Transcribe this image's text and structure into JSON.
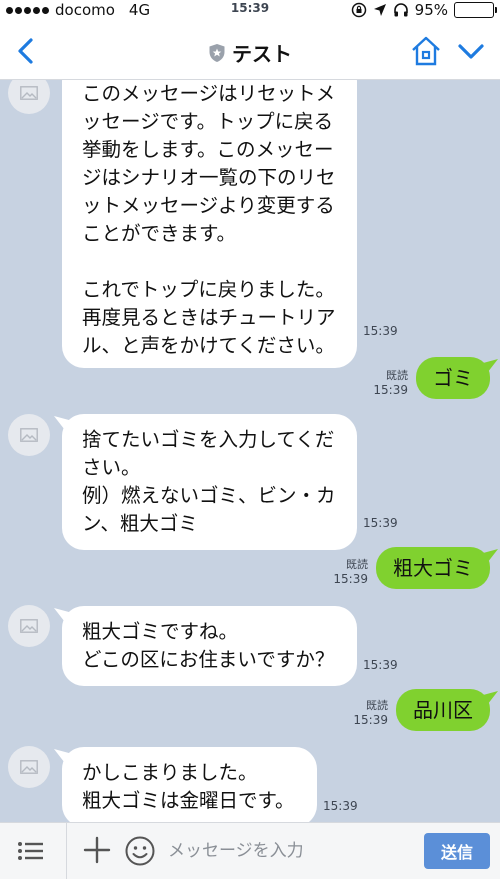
{
  "status_bar": {
    "carrier": "docomo",
    "network": "4G",
    "time": "15:39",
    "battery": "95%"
  },
  "header": {
    "title": "テスト",
    "icons": [
      "back-chevron-icon",
      "shield-star-icon",
      "home-icon",
      "chevron-down-icon"
    ]
  },
  "messages": [
    {
      "from": "bot",
      "text": "このメッセージはリセットメッセージです。トップに戻る挙動をします。このメッセージはシナリオ一覧の下のリセットメッセージより変更することができます。\n\nこれでトップに戻りました。\n再度見るときはチュートリアル、と声をかけてください。",
      "time": "15:39"
    },
    {
      "from": "user",
      "text": "ゴミ",
      "read": "既読",
      "time": "15:39"
    },
    {
      "from": "bot",
      "text": "捨てたいゴミを入力してください。\n例）燃えないゴミ、ビン・カン、粗大ゴミ",
      "time": "15:39"
    },
    {
      "from": "user",
      "text": "粗大ゴミ",
      "read": "既読",
      "time": "15:39"
    },
    {
      "from": "bot",
      "text": "粗大ゴミですね。\nどこの区にお住まいですか？",
      "time": "15:39"
    },
    {
      "from": "user",
      "text": "品川区",
      "read": "既読",
      "time": "15:39"
    },
    {
      "from": "bot",
      "text": "かしこまりました。\n粗大ゴミは金曜日です。",
      "time": "15:39"
    }
  ],
  "input_bar": {
    "placeholder": "メッセージを入力",
    "send_label": "送信"
  },
  "colors": {
    "chat_background": "#c7d2e1",
    "user_bubble": "#80d12f",
    "accent": "#1e7be0",
    "send_button": "#5b8fd8"
  }
}
